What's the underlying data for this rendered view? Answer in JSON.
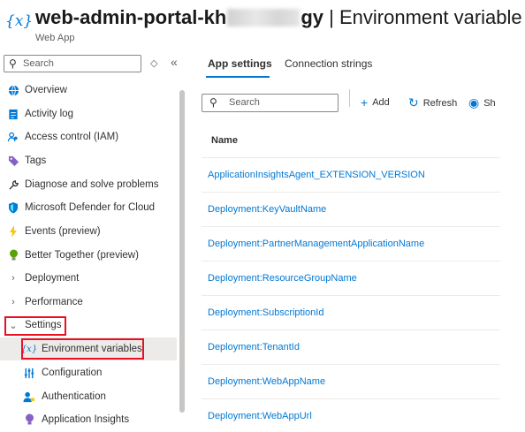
{
  "header": {
    "title_part1": "web-admin-portal-kh",
    "title_part2": "gy",
    "title_suffix": "| Environment variable",
    "subtitle": "Web App",
    "icon": "environment-variables-icon"
  },
  "sidebar": {
    "search_placeholder": "Search",
    "items": [
      {
        "label": "Overview",
        "icon": "globe-icon",
        "color": "#0078d4"
      },
      {
        "label": "Activity log",
        "icon": "log-icon",
        "color": "#0078d4"
      },
      {
        "label": "Access control (IAM)",
        "icon": "people-icon",
        "color": "#0078d4"
      },
      {
        "label": "Tags",
        "icon": "tag-icon",
        "color": "#8661c5"
      },
      {
        "label": "Diagnose and solve problems",
        "icon": "wrench-icon",
        "color": "#323130"
      },
      {
        "label": "Microsoft Defender for Cloud",
        "icon": "shield-icon",
        "color": "#0078d4"
      },
      {
        "label": "Events (preview)",
        "icon": "lightning-icon",
        "color": "#f2c811"
      },
      {
        "label": "Better Together (preview)",
        "icon": "bulb-icon",
        "color": "#57a300"
      },
      {
        "label": "Deployment",
        "icon": "chevron-right-icon"
      },
      {
        "label": "Performance",
        "icon": "chevron-right-icon"
      },
      {
        "label": "Settings",
        "icon": "chevron-down-icon"
      },
      {
        "label": "Environment variables",
        "icon": "environment-variables-icon",
        "color": "#0078d4"
      },
      {
        "label": "Configuration",
        "icon": "sliders-icon",
        "color": "#0078d4"
      },
      {
        "label": "Authentication",
        "icon": "user-key-icon",
        "color": "#0078d4"
      },
      {
        "label": "Application Insights",
        "icon": "insights-icon",
        "color": "#8661c5"
      }
    ]
  },
  "tabs": [
    {
      "label": "App settings",
      "active": true
    },
    {
      "label": "Connection strings",
      "active": false
    }
  ],
  "toolbar": {
    "search_placeholder": "Search",
    "add_label": "Add",
    "refresh_label": "Refresh",
    "show_label": "Sh"
  },
  "table": {
    "column_name": "Name",
    "rows": [
      "ApplicationInsightsAgent_EXTENSION_VERSION",
      "Deployment:KeyVaultName",
      "Deployment:PartnerManagementApplicationName",
      "Deployment:ResourceGroupName",
      "Deployment:SubscriptionId",
      "Deployment:TenantId",
      "Deployment:WebAppName",
      "Deployment:WebAppUrl"
    ]
  },
  "colors": {
    "accent": "#0078d4",
    "highlight_box": "#e81123",
    "active_bg": "#edebe9"
  }
}
